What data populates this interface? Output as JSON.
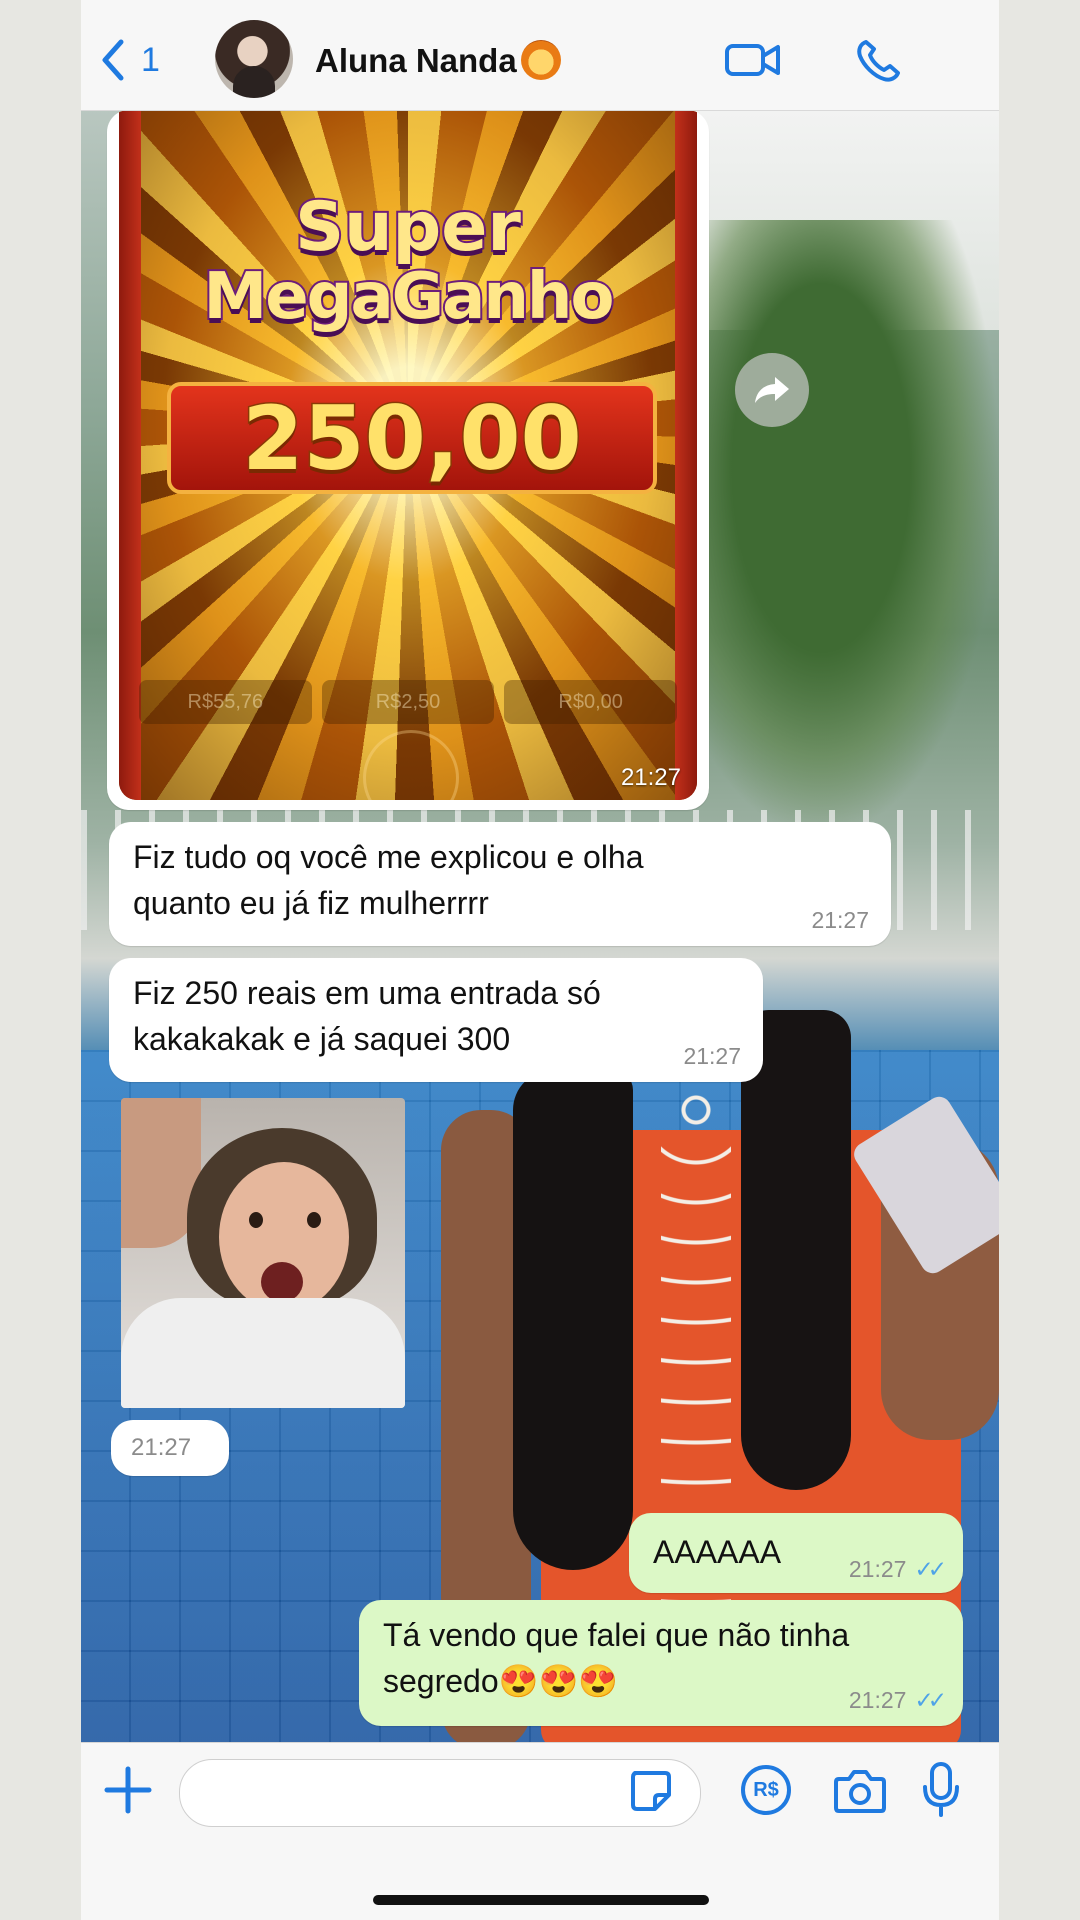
{
  "header": {
    "back_count": "1",
    "contact_name": "Aluna Nanda"
  },
  "messages": [
    {
      "type": "image",
      "direction": "in",
      "time": "21:27",
      "image": {
        "title_line1": "Super",
        "title_line2": "MegaGanho",
        "amount": "250,00",
        "stats": [
          "R$55,76",
          "R$2,50",
          "R$0,00"
        ]
      }
    },
    {
      "type": "text",
      "direction": "in",
      "text_lines": [
        "Fiz tudo oq você me explicou e olha",
        "quanto eu já fiz mulherrrr"
      ],
      "time": "21:27"
    },
    {
      "type": "text",
      "direction": "in",
      "text_lines": [
        "Fiz 250 reais em uma entrada só",
        "kakakakak e já saquei 300"
      ],
      "time": "21:27"
    },
    {
      "type": "sticker",
      "direction": "in",
      "time": "21:27"
    },
    {
      "type": "text",
      "direction": "out",
      "text_lines": [
        "AAAAAA"
      ],
      "time": "21:27",
      "status": "read"
    },
    {
      "type": "text",
      "direction": "out",
      "text_lines": [
        "Tá vendo que falei que não tinha",
        "segredo😍😍😍"
      ],
      "time": "21:27",
      "status": "read"
    }
  ],
  "input": {
    "pay_label": "R$"
  },
  "colors": {
    "accent": "#1f7ae0",
    "incoming_bubble": "#ffffff",
    "outgoing_bubble": "#dcf8c6",
    "read_ticks": "#4fa3e7"
  }
}
